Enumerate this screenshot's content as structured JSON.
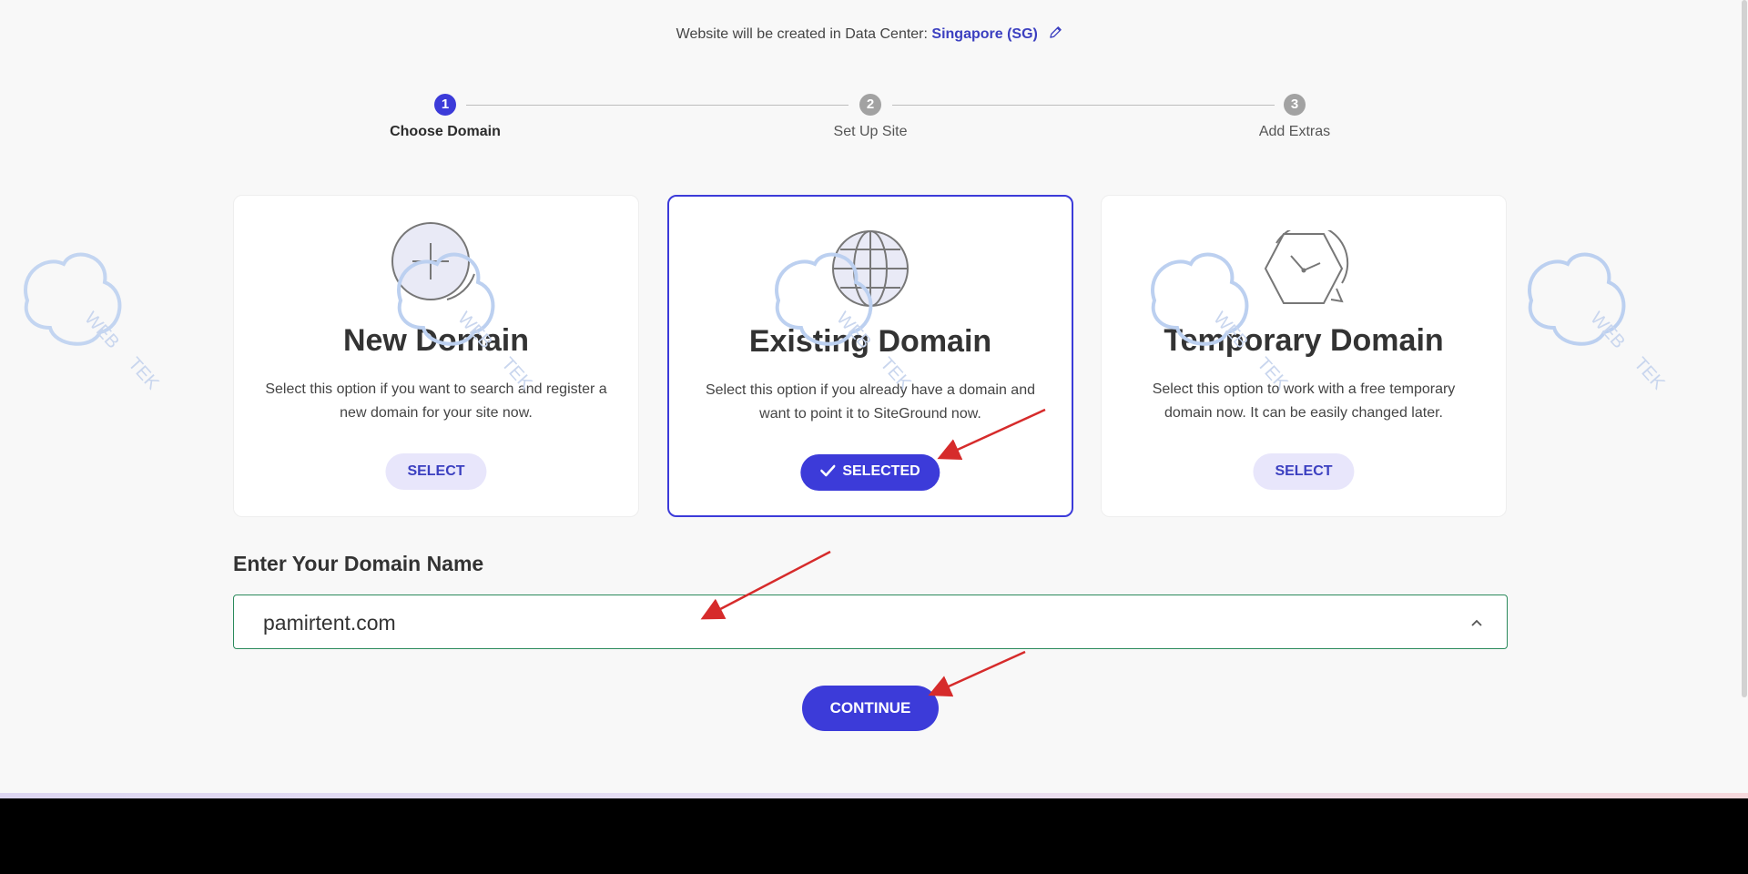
{
  "data_center": {
    "prefix": "Website will be created in Data Center:",
    "value": "Singapore (SG)",
    "edit_icon": "pencil-icon"
  },
  "stepper": {
    "steps": [
      {
        "number": "1",
        "label": "Choose Domain",
        "active": true
      },
      {
        "number": "2",
        "label": "Set Up Site",
        "active": false
      },
      {
        "number": "3",
        "label": "Add Extras",
        "active": false
      }
    ]
  },
  "cards": [
    {
      "title": "New Domain",
      "description": "Select this option if you want to search and register a new domain for your site now.",
      "button": "SELECT",
      "icon": "search-plus-icon",
      "selected": false
    },
    {
      "title": "Existing Domain",
      "description": "Select this option if you already have a domain and want to point it to SiteGround now.",
      "button": "SELECTED",
      "icon": "globe-icon",
      "selected": true
    },
    {
      "title": "Temporary Domain",
      "description": "Select this option to work with a free temporary domain now. It can be easily changed later.",
      "button": "SELECT",
      "icon": "clock-icon",
      "selected": false
    }
  ],
  "domain_input": {
    "label": "Enter Your Domain Name",
    "value": "pamirtent.com"
  },
  "continue_button": "CONTINUE",
  "watermark": {
    "text_primary": "WEB",
    "text_secondary": "TEK"
  },
  "colors": {
    "accent": "#3c3bd9",
    "accent_soft": "#e8e6fb",
    "input_border": "#2b8a5c",
    "annotation_arrow": "#d62b2b",
    "watermark": "#b9cdef"
  }
}
